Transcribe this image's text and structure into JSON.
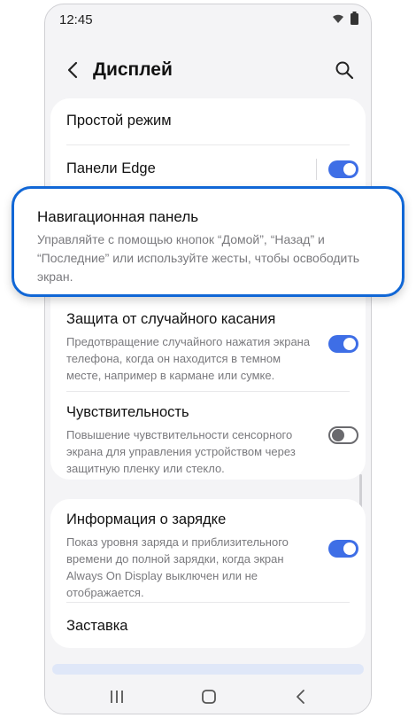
{
  "status": {
    "time": "12:45"
  },
  "header": {
    "title": "Дисплей"
  },
  "rows": {
    "simple_mode": {
      "label": "Простой режим"
    },
    "edge_panels": {
      "label": "Панели Edge",
      "enabled": true
    },
    "navigation": {
      "label": "Навигационная панель",
      "description": "Управляйте с помощью кнопок “Домой”, “Назад” и “Последние” или используйте жесты, чтобы освободить экран."
    },
    "accidental_touch": {
      "label": "Защита от случайного касания",
      "description": "Предотвращение случайного нажатия экрана телефона, когда он находится в темном месте, например в кармане или сумке.",
      "enabled": true
    },
    "sensitivity": {
      "label": "Чувствительность",
      "description": "Повышение чувствительности сенсорного экрана для управления устройством через защитную пленку или стекло.",
      "enabled": false
    },
    "charging_info": {
      "label": "Информация о зарядке",
      "description": "Показ уровня заряда и приблизительного времени до полной зарядки, когда экран Always On Display выключен или не отображается.",
      "enabled": true
    },
    "screensaver": {
      "label": "Заставка"
    }
  },
  "colors": {
    "accent": "#3e6ee6",
    "highlight_border": "#1167d6"
  },
  "icons": [
    "back-arrow-icon",
    "search-icon",
    "wifi-icon",
    "battery-icon",
    "recents-icon",
    "home-icon",
    "back-nav-icon"
  ]
}
